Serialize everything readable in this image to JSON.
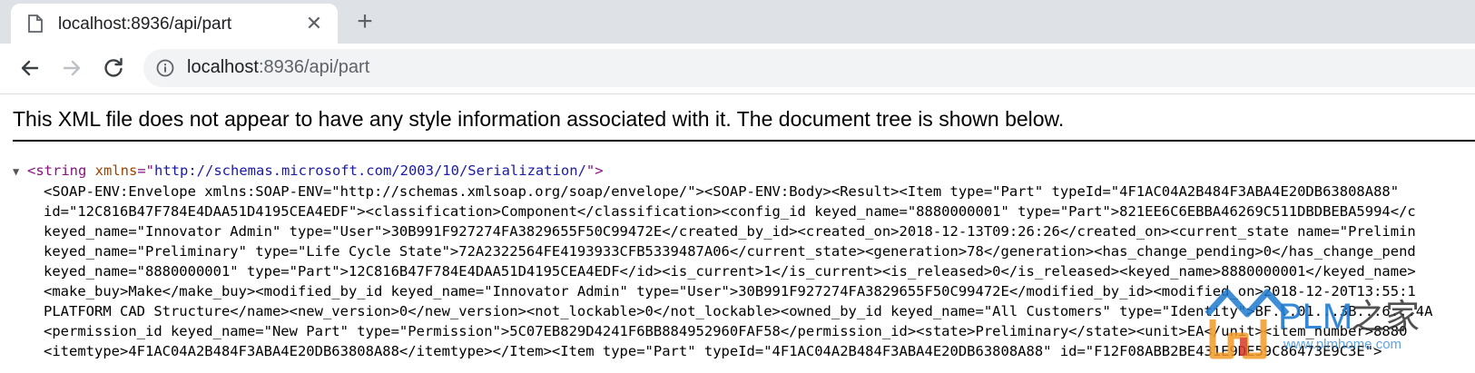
{
  "tab": {
    "title": "localhost:8936/api/part",
    "close_glyph": "✕",
    "new_tab_glyph": "+"
  },
  "toolbar": {
    "url_host": "localhost",
    "url_rest": ":8936/api/part"
  },
  "viewer": {
    "notice": "This XML file does not appear to have any style information associated with it. The document tree is shown below.",
    "root": {
      "tag_open": "<string ",
      "attr_name": "xmlns",
      "attr_eq": "=\"",
      "attr_value": "http://schemas.microsoft.com/2003/10/Serialization/",
      "tag_close": "\">"
    },
    "lines": [
      "<SOAP-ENV:Envelope xmlns:SOAP-ENV=\"http://schemas.xmlsoap.org/soap/envelope/\"><SOAP-ENV:Body><Result><Item type=\"Part\" typeId=\"4F1AC04A2B484F3ABA4E20DB63808A88\"",
      "id=\"12C816B47F784E4DAA51D4195CEA4EDF\"><classification>Component</classification><config_id keyed_name=\"8880000001\" type=\"Part\">821EE6C6EBBA46269C511DBDBEBA5994</c",
      "keyed_name=\"Innovator Admin\" type=\"User\">30B991F927274FA3829655F50C99472E</created_by_id><created_on>2018-12-13T09:26:26</created_on><current_state name=\"Prelimin",
      "keyed_name=\"Preliminary\" type=\"Life Cycle State\">72A2322564FE4193933CFB5339487A06</current_state><generation>78</generation><has_change_pending>0</has_change_pend",
      "keyed_name=\"8880000001\" type=\"Part\">12C816B47F784E4DAA51D4195CEA4EDF</id><is_current>1</is_current><is_released>0</is_released><keyed_name>8880000001</keyed_name>",
      "<make_buy>Make</make_buy><modified_by_id keyed_name=\"Innovator Admin\" type=\"User\">30B991F927274FA3829655F50C99472E</modified_by_id><modified_on>2018-12-20T13:55:1",
      "PLATFORM CAD Structure</name><new_version>0</new_version><not_lockable>0</not_lockable><owned_by_id keyed_name=\"All Customers\" type=\"Identity\">BF...01...3B...6...4A",
      "<permission_id keyed_name=\"New Part\" type=\"Permission\">5C07EB829D4241F6BB884952960FAF58</permission_id><state>Preliminary</state><unit>EA</unit><item_number>8880",
      "<itemtype>4F1AC04A2B484F3ABA4E20DB63808A88</itemtype></Item><Item type=\"Part\" typeId=\"4F1AC04A2B484F3ABA4E20DB63808A88\" id=\"F12F08ABB2BE431E9DE59C86473E9C3E\">"
    ]
  },
  "watermark": {
    "brand": "PLM",
    "suffix": "之家",
    "site": "www.plmhome.com",
    "colors": {
      "orange": "#f39a26",
      "blue": "#1f7bd0",
      "red": "#d83a2a"
    }
  }
}
